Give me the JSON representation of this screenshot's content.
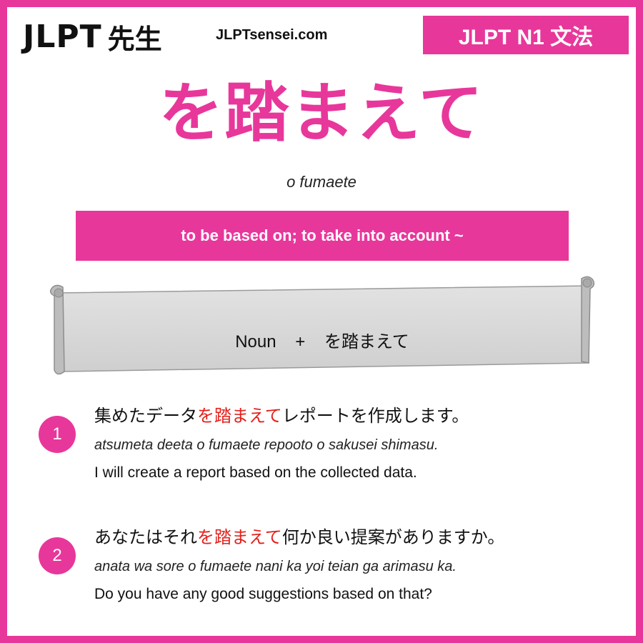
{
  "header": {
    "logo_text": "JLPT",
    "logo_kanji": "先生",
    "site": "JLPTsensei.com",
    "level_badge": "JLPT N1 文法"
  },
  "grammar": {
    "title": "を踏まえて",
    "romaji": "o fumaete",
    "meaning": "to be based on; to take into account ~",
    "formula": {
      "left": "Noun",
      "operator": "+",
      "right": "を踏まえて"
    }
  },
  "examples": [
    {
      "number": "1",
      "jp_before": "集めたデータ",
      "jp_highlight": "を踏まえて",
      "jp_after": "レポートを作成します。",
      "romaji": "atsumeta deeta o fumaete repooto o sakusei shimasu.",
      "english": "I will create a report based on the collected data."
    },
    {
      "number": "2",
      "jp_before": "あなたはそれ",
      "jp_highlight": "を踏まえて",
      "jp_after": "何か良い提案がありますか。",
      "romaji": "anata wa sore o fumaete nani ka yoi teian ga arimasu ka.",
      "english": "Do you have any good suggestions based on that?"
    }
  ],
  "colors": {
    "accent": "#e8379b",
    "highlight": "#e3201b"
  }
}
